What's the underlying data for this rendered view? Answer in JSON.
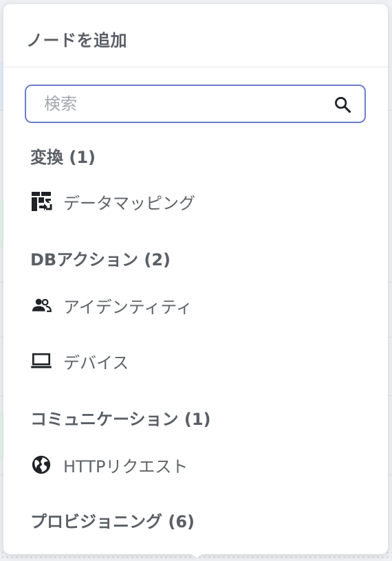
{
  "popover": {
    "title": "ノードを追加"
  },
  "search": {
    "placeholder": "検索",
    "value": ""
  },
  "sections": [
    {
      "header": "変換 (1)",
      "items": [
        {
          "label": "データマッピング",
          "icon": "data-mapping-icon"
        }
      ]
    },
    {
      "header": "DBアクション (2)",
      "items": [
        {
          "label": "アイデンティティ",
          "icon": "people-icon"
        },
        {
          "label": "デバイス",
          "icon": "laptop-icon"
        }
      ]
    },
    {
      "header": "コミュニケーション (1)",
      "items": [
        {
          "label": "HTTPリクエスト",
          "icon": "globe-icon"
        }
      ]
    },
    {
      "header": "プロビジョニング (6)",
      "items": []
    }
  ],
  "colors": {
    "accent_border": "#6b7ec9",
    "heading_text": "#5a5f66",
    "item_text": "#5f6469",
    "icon": "#1f2328"
  }
}
